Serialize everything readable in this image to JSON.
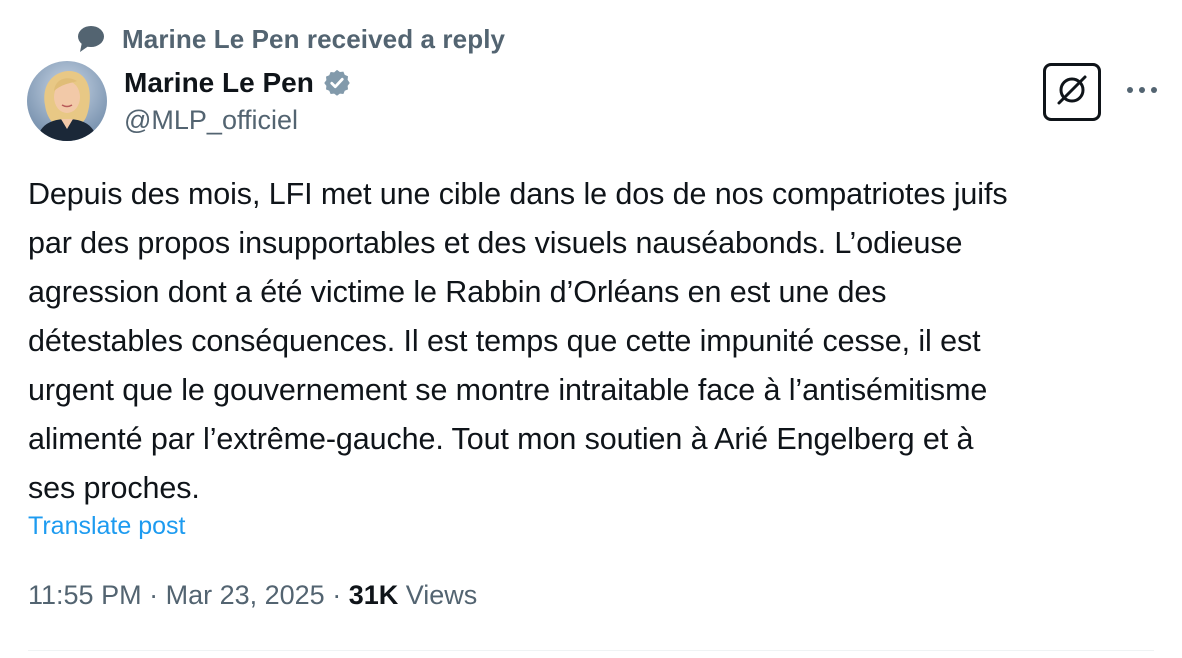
{
  "context": {
    "text": "Marine Le Pen received a reply",
    "icon": "speech-bubble-icon"
  },
  "author": {
    "display_name": "Marine Le Pen",
    "handle": "@MLP_officiel",
    "verified": true,
    "verified_color": "#829aab"
  },
  "tweet": {
    "text": "Depuis des mois, LFI met une cible dans le dos de nos compatriotes juifs\npar des propos insupportables et des visuels nauséabonds. L’odieuse\nagression dont a été victime le Rabbin d’Orléans en est une des\ndétestables conséquences. Il est temps que cette impunité cesse, il est\nurgent que le gouvernement se montre intraitable face à l’antisémitisme\nalimenté par l’extrême-gauche. Tout mon soutien à Arié Engelberg et à\nses proches.",
    "translate_label": "Translate post"
  },
  "meta": {
    "time": "11:55 PM",
    "separator": " · ",
    "date": "Mar 23, 2025",
    "views_count": "31K",
    "views_label": " Views"
  },
  "colors": {
    "text_primary": "#0f1419",
    "text_secondary": "#536471",
    "link": "#1d9bf0",
    "divider": "#eff3f4"
  }
}
